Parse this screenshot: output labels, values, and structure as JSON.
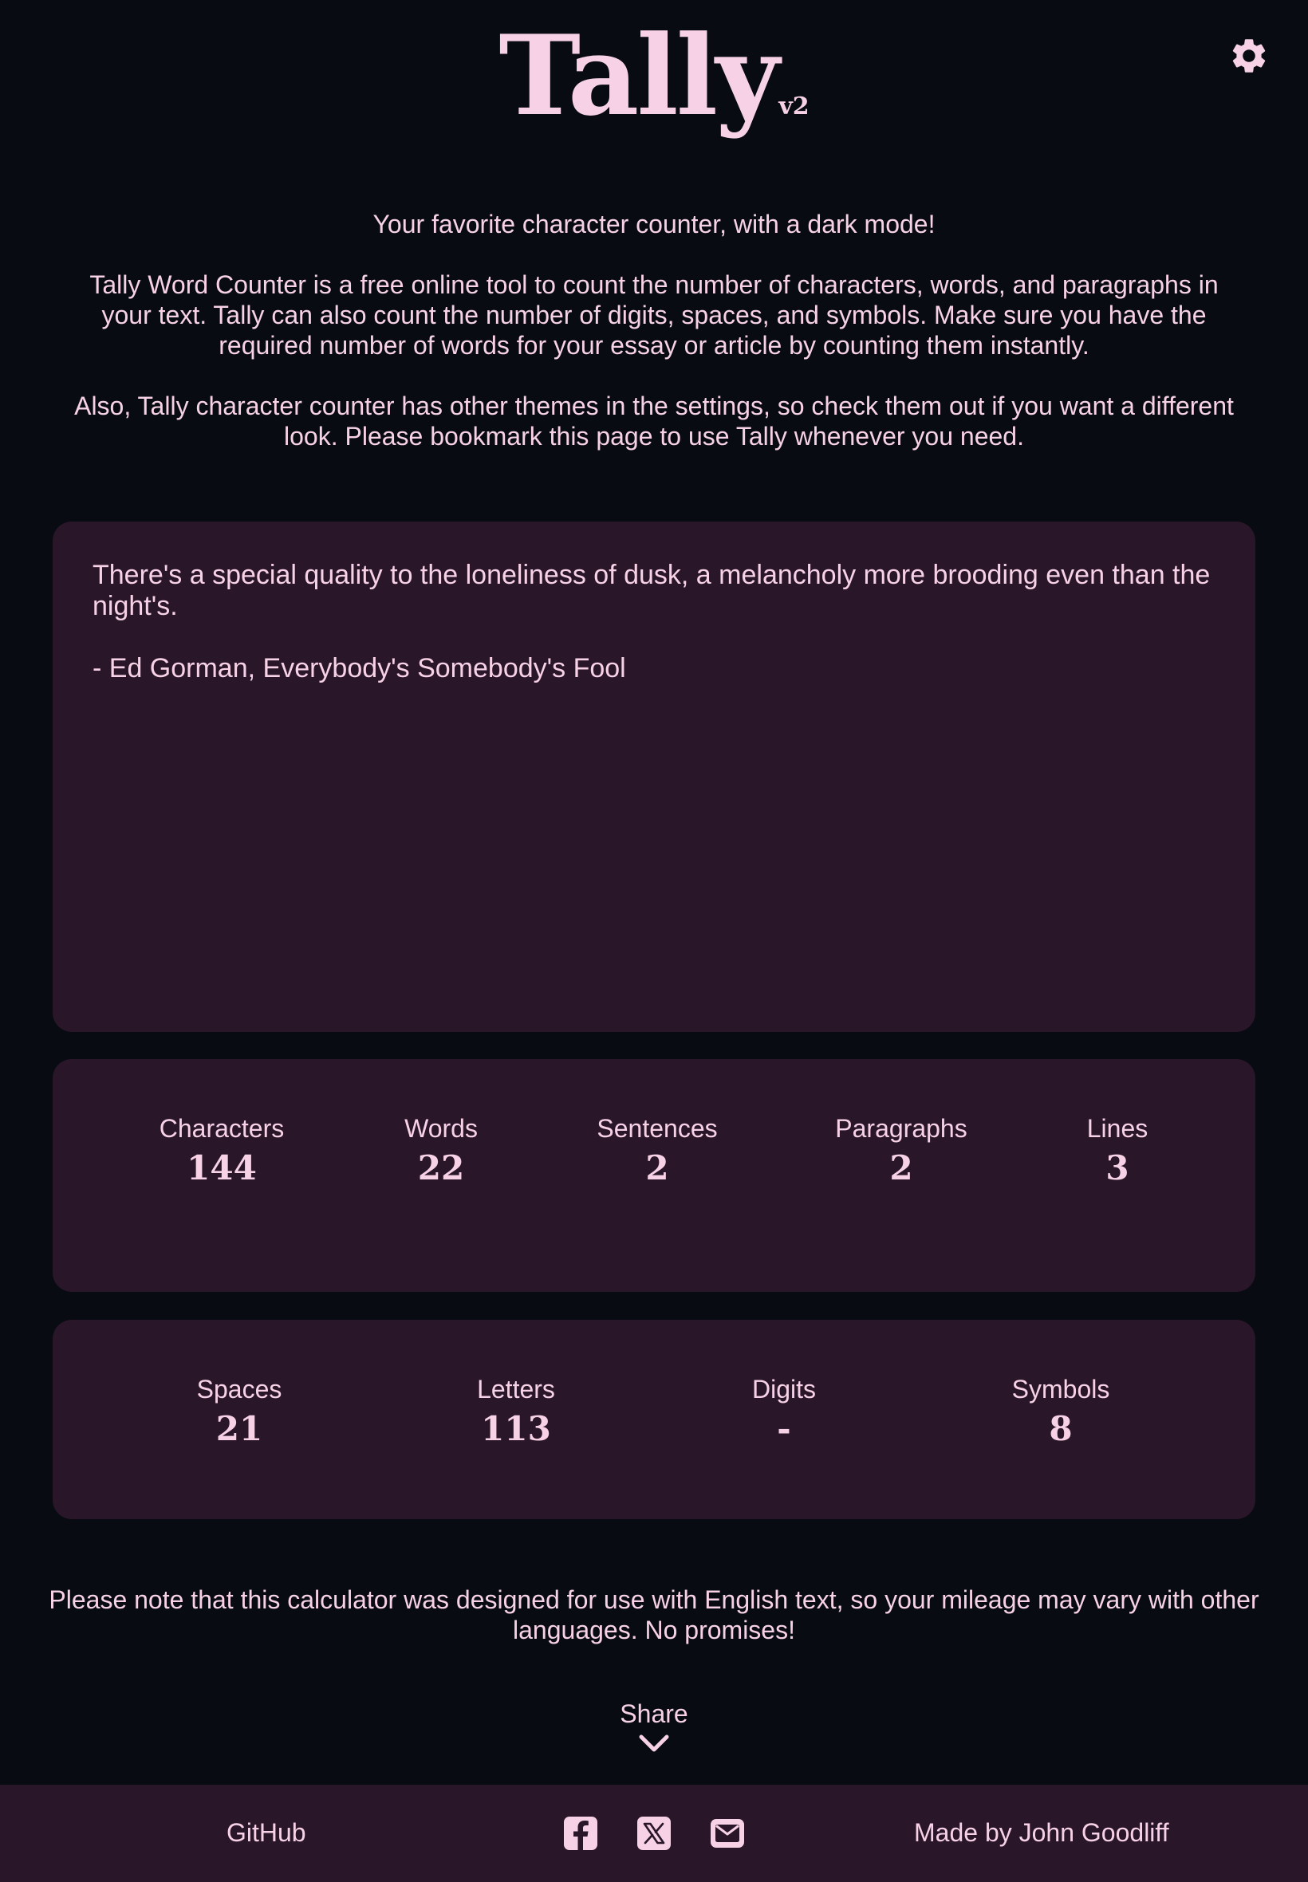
{
  "header": {
    "title": "Tally",
    "version": "v2",
    "settings_icon": "gear-icon"
  },
  "intro": {
    "tagline": "Your favorite character counter, with a dark mode!",
    "description": "Tally Word Counter is a free online tool to count the number of characters, words, and paragraphs in your text. Tally can also count the number of digits, spaces, and symbols. Make sure you have the required number of words for your essay or article by counting them instantly.",
    "themes_note": "Also, Tally character counter has other themes in the settings, so check them out if you want a different look. Please bookmark this page to use Tally whenever you need."
  },
  "editor": {
    "value": "There's a special quality to the loneliness of dusk, a melancholy more brooding even than the night's.\n\n- Ed Gorman, Everybody's Somebody's Fool"
  },
  "stats_primary": [
    {
      "label": "Characters",
      "value": "144"
    },
    {
      "label": "Words",
      "value": "22"
    },
    {
      "label": "Sentences",
      "value": "2"
    },
    {
      "label": "Paragraphs",
      "value": "2"
    },
    {
      "label": "Lines",
      "value": "3"
    }
  ],
  "stats_secondary": [
    {
      "label": "Spaces",
      "value": "21"
    },
    {
      "label": "Letters",
      "value": "113"
    },
    {
      "label": "Digits",
      "value": "-"
    },
    {
      "label": "Symbols",
      "value": "8"
    }
  ],
  "note": "Please note that this calculator was designed for use with English text, so your mileage may vary with other languages. No promises!",
  "share": {
    "label": "Share",
    "icon": "chevron-down-icon"
  },
  "footer": {
    "github_label": "GitHub",
    "icons": [
      "facebook-icon",
      "x-icon",
      "mail-icon"
    ],
    "credit": "Made by John Goodliff"
  },
  "colors": {
    "background": "#080b12",
    "panel": "#2a1629",
    "text": "#f7d2e6"
  }
}
